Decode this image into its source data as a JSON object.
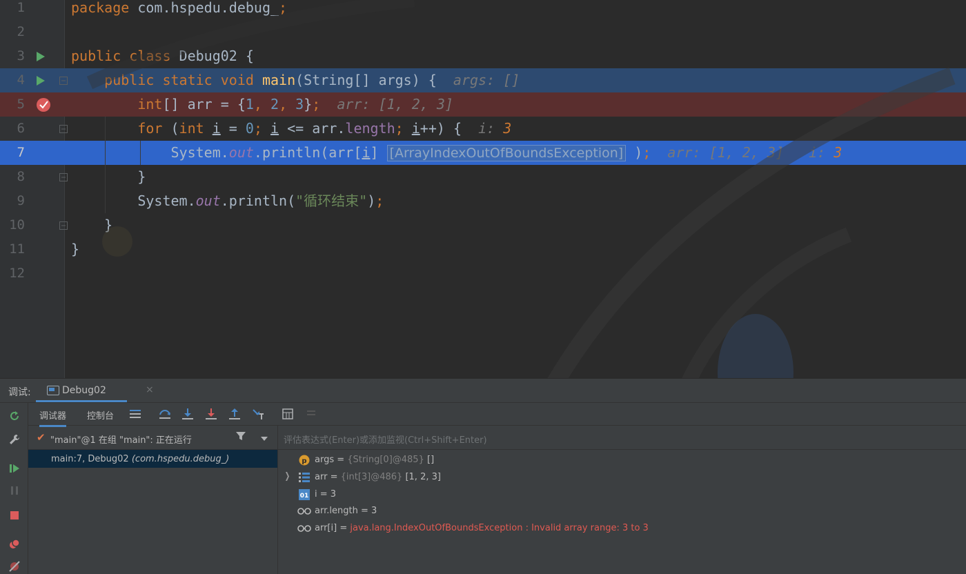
{
  "editor": {
    "lines": [
      {
        "n": "1",
        "code": [
          {
            "t": "package ",
            "c": "kw"
          },
          {
            "t": "com.hspedu.debug_",
            "c": "pl"
          },
          {
            "t": ";",
            "c": "kw"
          }
        ]
      },
      {
        "n": "2",
        "code": []
      },
      {
        "n": "3",
        "code": [
          {
            "t": "public class ",
            "c": "kw"
          },
          {
            "t": "Debug02 {",
            "c": "pl"
          }
        ]
      },
      {
        "n": "4",
        "code": [
          {
            "t": "    public static void ",
            "c": "kw"
          },
          {
            "t": "main",
            "c": "fn"
          },
          {
            "t": "(String[] args) {  ",
            "c": "pl"
          },
          {
            "t": "args: []",
            "c": "hint"
          }
        ]
      },
      {
        "n": "5",
        "code": [
          {
            "t": "        int",
            "c": "kw"
          },
          {
            "t": "[] arr = {",
            "c": "pl"
          },
          {
            "t": "1",
            "c": "num"
          },
          {
            "t": ", ",
            "c": "kw"
          },
          {
            "t": "2",
            "c": "num"
          },
          {
            "t": ", ",
            "c": "kw"
          },
          {
            "t": "3",
            "c": "num"
          },
          {
            "t": "}",
            "c": "pl"
          },
          {
            "t": ";  ",
            "c": "kw"
          },
          {
            "t": "arr: [1, 2, 3]",
            "c": "hint"
          }
        ]
      },
      {
        "n": "6",
        "code": [
          {
            "t": "        for ",
            "c": "kw"
          },
          {
            "t": "(",
            "c": "pl"
          },
          {
            "t": "int ",
            "c": "kw"
          },
          {
            "t": "i",
            "c": "ul pl"
          },
          {
            "t": " = ",
            "c": "pl"
          },
          {
            "t": "0",
            "c": "num"
          },
          {
            "t": "; ",
            "c": "kw"
          },
          {
            "t": "i",
            "c": "ul pl"
          },
          {
            "t": " <= arr.",
            "c": "pl"
          },
          {
            "t": "length",
            "c": "fld"
          },
          {
            "t": "; ",
            "c": "kw"
          },
          {
            "t": "i",
            "c": "ul pl"
          },
          {
            "t": "++) {  ",
            "c": "pl"
          },
          {
            "t": "i: ",
            "c": "hint"
          },
          {
            "t": "3",
            "c": "hintnum"
          }
        ]
      },
      {
        "n": "7",
        "code": [
          {
            "t": "            System.",
            "c": "pl"
          },
          {
            "t": "out",
            "c": "it"
          },
          {
            "t": ".println(arr[",
            "c": "pl"
          },
          {
            "t": "i",
            "c": "ul pl"
          },
          {
            "t": "]",
            "c": "pl"
          },
          {
            "t": " ",
            "c": "pl"
          },
          {
            "t": "[ArrayIndexOutOfBoundsException]",
            "c": "exch"
          },
          {
            "t": " )",
            "c": "pl"
          },
          {
            "t": ";  ",
            "c": "kw"
          },
          {
            "t": "arr: [1, 2, 3]   i: ",
            "c": "hint"
          },
          {
            "t": "3",
            "c": "hintnum"
          }
        ]
      },
      {
        "n": "8",
        "code": [
          {
            "t": "        }",
            "c": "pl"
          }
        ]
      },
      {
        "n": "9",
        "code": [
          {
            "t": "        System.",
            "c": "pl"
          },
          {
            "t": "out",
            "c": "it"
          },
          {
            "t": ".println(",
            "c": "pl"
          },
          {
            "t": "\"循环结束\"",
            "c": "str"
          },
          {
            "t": ")",
            "c": "pl"
          },
          {
            "t": ";",
            "c": "kw"
          }
        ]
      },
      {
        "n": "10",
        "code": [
          {
            "t": "    }",
            "c": "pl"
          }
        ]
      },
      {
        "n": "11",
        "code": [
          {
            "t": "}",
            "c": "pl"
          }
        ]
      },
      {
        "n": "12",
        "code": []
      }
    ]
  },
  "debug": {
    "label": "调试:",
    "tab": "Debug02",
    "tab_close": "×",
    "toolbar_tabs": [
      "调试器",
      "控制台"
    ],
    "thread": "\"main\"@1 在组 \"main\": 正在运行",
    "frame": "main:7, Debug02",
    "frame_pkg": "(com.hspedu.debug_)",
    "eval_placeholder": "评估表达式(Enter)或添加监视(Ctrl+Shift+Enter)",
    "variables": [
      {
        "name": "args",
        "eq": " = ",
        "type": "{String[0]@485}",
        "value": " []",
        "badge": "P",
        "badge_color": "#d99a2e"
      },
      {
        "name": "arr",
        "eq": " = ",
        "type": "{int[3]@486}",
        "value": " [1, 2, 3]",
        "badge": "list",
        "badge_color": "#4a88c7"
      },
      {
        "name": "i",
        "eq": " = ",
        "type": "",
        "value": "3",
        "badge": "01",
        "badge_color": "#4a88c7"
      },
      {
        "name": "arr.length",
        "eq": " = ",
        "type": "",
        "value": "3",
        "badge": "oo",
        "badge_color": "#bbbbbb"
      },
      {
        "name": "arr[i]",
        "eq": " = ",
        "type": "",
        "value": "java.lang.IndexOutOfBoundsException : Invalid array range: 3 to 3",
        "badge": "oo",
        "badge_color": "#bbbbbb",
        "error": true
      }
    ]
  }
}
